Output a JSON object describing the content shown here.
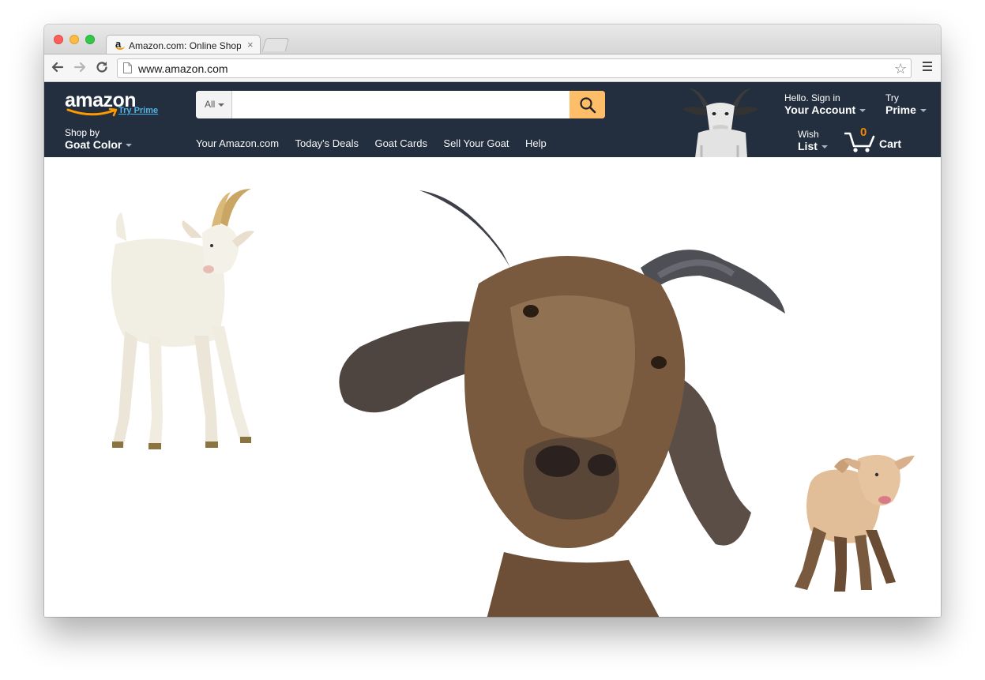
{
  "browser": {
    "tab": {
      "favicon_letter": "a",
      "title": "Amazon.com: Online Shopping",
      "close_glyph": "×"
    },
    "address_bar": {
      "url": "www.amazon.com"
    },
    "icons": [
      "back-arrow-icon",
      "forward-arrow-icon",
      "reload-icon",
      "page-icon",
      "bookmark-star-icon",
      "menu-icon"
    ]
  },
  "header": {
    "logo": {
      "word": "amazon",
      "prime_link": "Try Prime"
    },
    "shop_by": {
      "small": "Shop by",
      "big": "Goat Color"
    },
    "search": {
      "department": "All",
      "value": "",
      "placeholder": ""
    },
    "subnav": [
      "Your Amazon.com",
      "Today's Deals",
      "Goat Cards",
      "Sell Your Goat",
      "Help"
    ],
    "account": {
      "small": "Hello. Sign in",
      "big": "Your Account"
    },
    "prime": {
      "small": "Try",
      "big": "Prime"
    },
    "wish": {
      "small": "Wish",
      "big": "List"
    },
    "cart": {
      "count": "0",
      "label": "Cart"
    }
  },
  "colors": {
    "header_bg": "#232f3e",
    "search_button": "#febd69",
    "logo_smile": "#ff9900",
    "cart_count": "#f08804",
    "prime_link": "#4fb3e6"
  },
  "images": [
    "header-goat",
    "white-goat",
    "brown-goat-closeup",
    "baby-goat"
  ]
}
